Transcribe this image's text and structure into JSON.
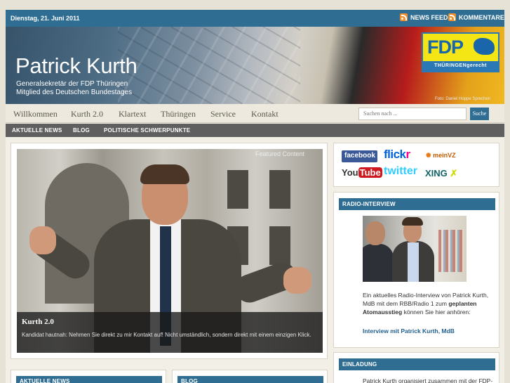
{
  "topbar": {
    "date": "Dienstag, 21. Juni 2011",
    "news_feed": "NEWS FEED",
    "comments_feed": "KOMMENTARE"
  },
  "header": {
    "title": "Patrick Kurth",
    "subtitle_line1": "Generalsekretär der FDP Thüringen",
    "subtitle_line2": "Mitglied des Deutschen Bundestages",
    "logo_word": "FDP",
    "logo_tag": "THÜRINGENgerecht",
    "credit": "Foto: Daniel Hoppe Sprechen"
  },
  "nav": {
    "items": [
      "Willkommen",
      "Kurth 2.0",
      "Klartext",
      "Thüringen",
      "Service",
      "Kontakt"
    ],
    "search_placeholder": "Suchen nach ...",
    "search_button": "Suche"
  },
  "subnav": {
    "items": [
      "AKTUELLE NEWS",
      "BLOG",
      "POLITISCHE SCHWERPUNKTE"
    ]
  },
  "featured": {
    "label": "Featured Content",
    "title": "Kurth 2.0",
    "description": "Kandidat hautnah: Nehmen Sie direkt zu mir Kontakt auf! Nicht umständlich, sondern direkt mit einem einzigen Klick."
  },
  "bottom": {
    "news_title": "AKTUELLE NEWS",
    "blog_title": "BLOG"
  },
  "social": {
    "facebook": "facebook",
    "flickr_a": "flick",
    "flickr_b": "r",
    "meinvz": "meinVZ",
    "youtube_a": "You",
    "youtube_b": "Tube",
    "twitter": "twitter",
    "xing": "XING"
  },
  "radio": {
    "title": "RADIO-INTERVIEW",
    "text_1": "Ein aktuelles Radio-Interview von Patrick Kurth, MdB mit dem RBB/Radio 1 zum",
    "text_bold": "geplanten Atomausstieg",
    "text_2": "können Sie hier anhören:",
    "link": "Interview mit Patrick Kurth, MdB"
  },
  "invite": {
    "title": "EINLADUNG",
    "text": "Patrick Kurth organisiert zusammen mit der FDP-Bundestagsfraktion den bundesweit"
  },
  "colors": {
    "primary_blue": "#2f6d92",
    "subnav_gray": "#5f5f5f",
    "page_bg": "#e6e2d6",
    "fdp_yellow": "#f4e515"
  }
}
